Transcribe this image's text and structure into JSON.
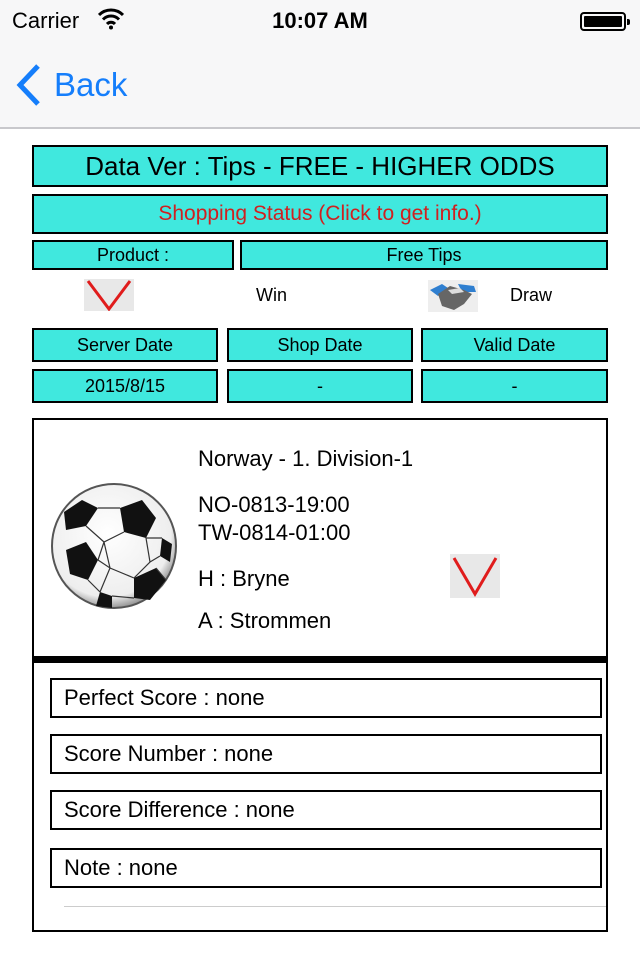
{
  "status_bar": {
    "carrier": "Carrier",
    "time": "10:07 AM",
    "wifi_icon": "wifi-icon",
    "battery_icon": "battery-icon"
  },
  "nav": {
    "back_label": "Back",
    "back_icon": "chevron-left-icon"
  },
  "header": {
    "data_version": "Data Ver : Tips - FREE - HIGHER ODDS",
    "shopping_status": "Shopping Status (Click to get info.)",
    "product_label": "Product :",
    "product_value": "Free Tips"
  },
  "legend": {
    "win_label": "Win",
    "win_icon": "check-v-icon",
    "draw_label": "Draw",
    "draw_icon": "handshake-icon"
  },
  "dates": {
    "headers": [
      "Server Date",
      "Shop Date",
      "Valid Date"
    ],
    "values": [
      "2015/8/15",
      "-",
      "-"
    ]
  },
  "match": {
    "league": "Norway - 1. Division-1",
    "local_time": "NO-0813-19:00",
    "tw_time": "TW-0814-01:00",
    "home": "H : Bryne",
    "away": "A : Strommen",
    "ball_icon": "soccer-ball-icon",
    "result_icon": "check-v-icon"
  },
  "details": [
    "Perfect Score : none",
    "Score Number : none",
    "Score Difference : none",
    "Note : none"
  ],
  "colors": {
    "accent": "#157efb",
    "cyan": "#40e8de",
    "status_red": "#d02020"
  }
}
